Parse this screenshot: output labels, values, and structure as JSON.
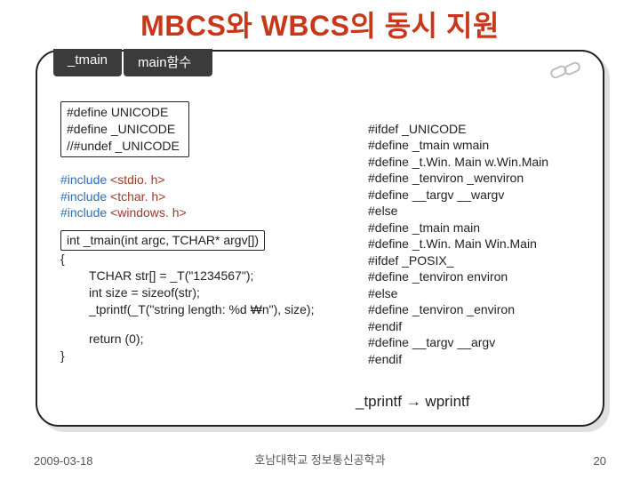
{
  "title": "MBCS와 WBCS의 동시 지원",
  "tabs": {
    "tab1": "_tmain",
    "tab2": "main함수"
  },
  "left": {
    "def1": "#define UNICODE",
    "def2": "#define _UNICODE",
    "def3": "//#undef _UNICODE",
    "inc1_a": "#include",
    "inc1_b": "<stdio. h>",
    "inc2_a": "#include",
    "inc2_b": "<tchar. h>",
    "inc3_a": "#include",
    "inc3_b": "<windows. h>",
    "sig": "int _tmain(int argc, TCHAR* argv[])",
    "ob": "{",
    "l1": "TCHAR str[] = _T(\"1234567\");",
    "l2": "int size = sizeof(str);",
    "l3": "_tprintf(_T(\"string length: %d ₩n\"), size);",
    "ret": "return (0);",
    "cb": "}"
  },
  "right": {
    "r1": "#ifdef _UNICODE",
    "r2": "#define _tmain          wmain",
    "r3": "#define _t.Win. Main   w.Win.Main",
    "r4": "#define _tenviron    _wenviron",
    "r5": "#define __targv      __wargv",
    "r6": "#else",
    "r7": "#define _tmain        main",
    "r8": "#define _t.Win. Main    Win.Main",
    "r9": "#ifdef _POSIX_",
    "r10": "#define _tenviron   environ",
    "r11": "#else",
    "r12": "#define _tenviron  _environ",
    "r13": "#endif",
    "r14": "#define __targv       __argv",
    "r15": "#endif"
  },
  "note": "_tprintf → wprintf",
  "footer": {
    "date": "2009-03-18",
    "center": "호남대학교 정보통신공학과",
    "page": "20"
  }
}
